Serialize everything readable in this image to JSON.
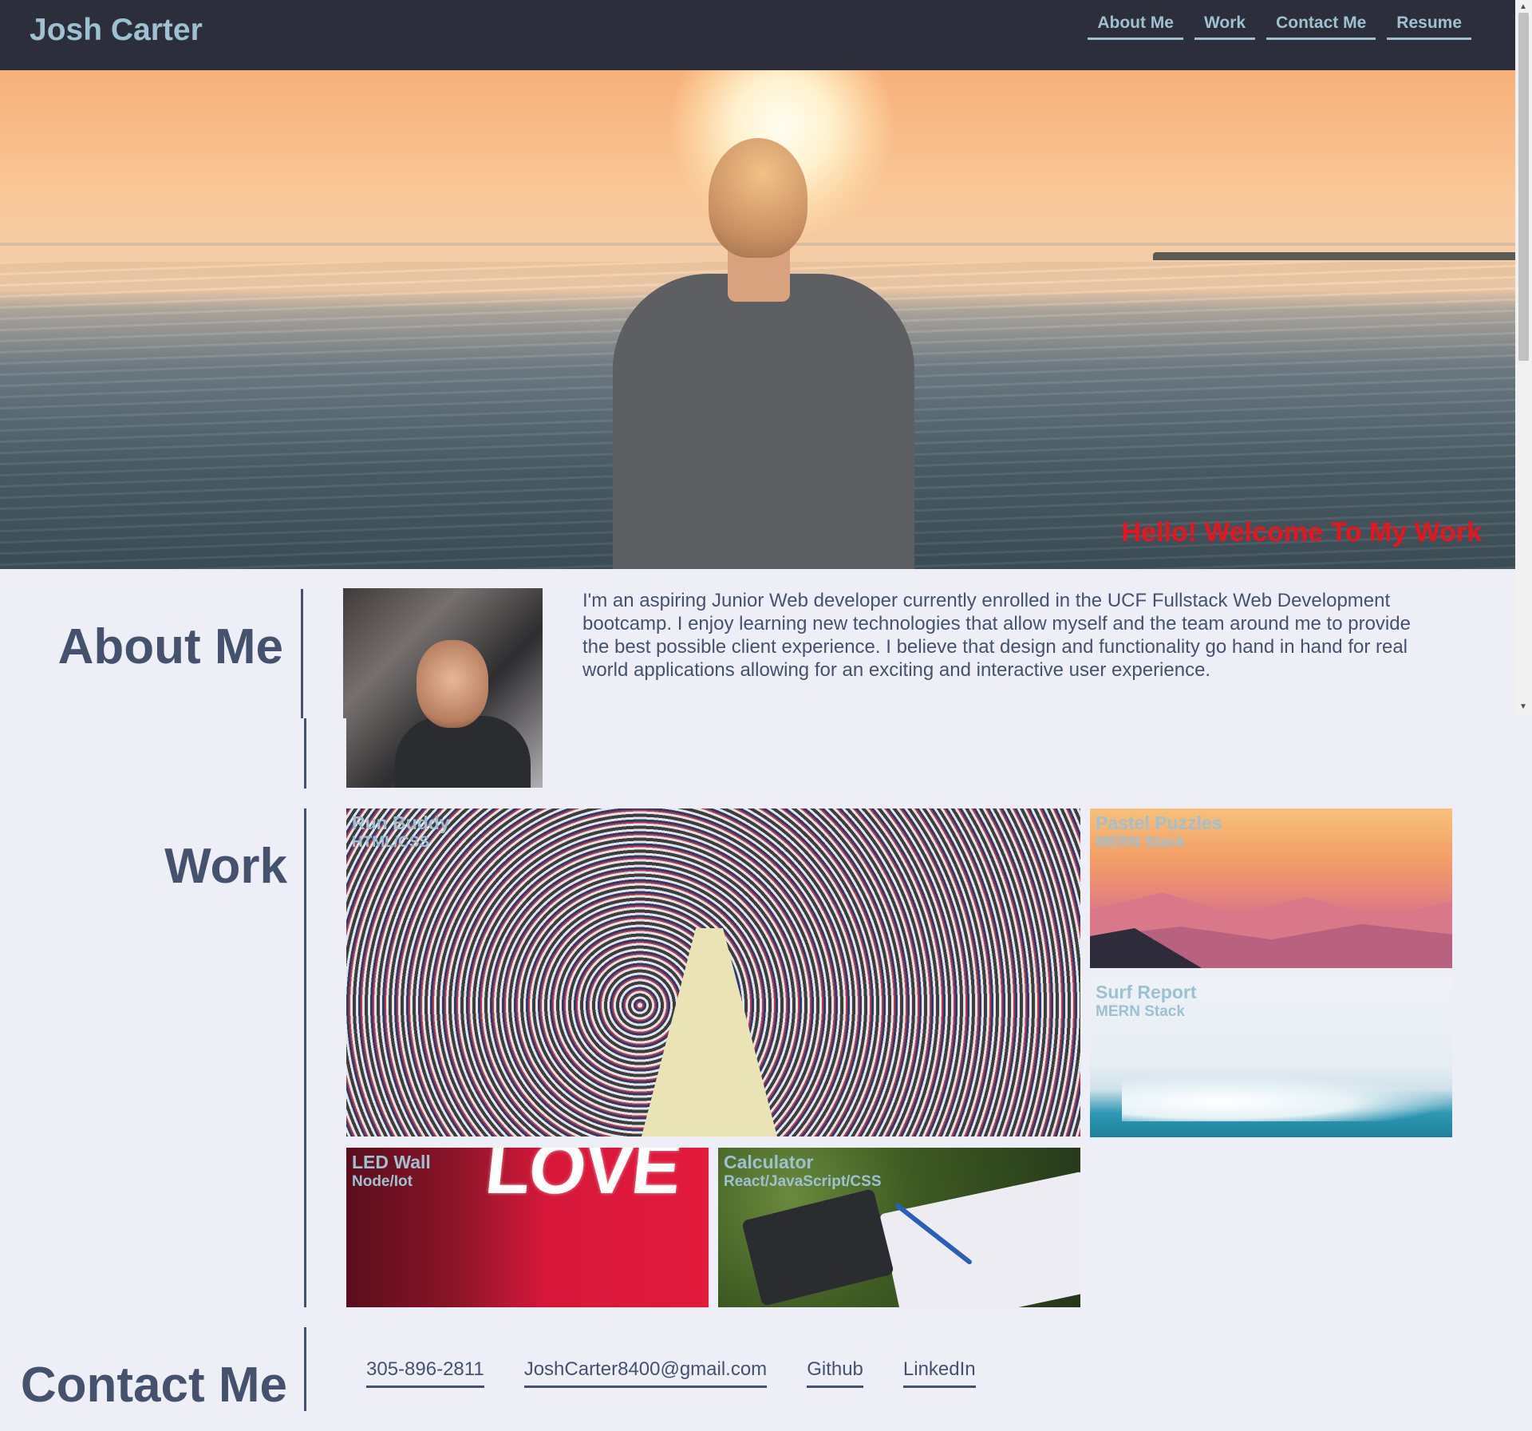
{
  "header": {
    "brand": "Josh Carter",
    "nav": [
      "About Me",
      "Work",
      "Contact Me",
      "Resume"
    ]
  },
  "hero": {
    "welcome": "Hello! Welcome To My Work"
  },
  "about": {
    "title": "About Me",
    "text": "I'm an aspiring Junior Web developer currently enrolled in the UCF Fullstack Web Development bootcamp. I enjoy learning new technologies that allow myself and the team around me to provide the best possible client experience. I believe that design and functionality go hand in hand for real world applications allowing for an exciting and interactive user experience."
  },
  "work": {
    "title": "Work",
    "projects": [
      {
        "name": "Run Buddy",
        "tech": "HTML/CSS"
      },
      {
        "name": "Pastel Puzzles",
        "tech": "MERN Stack"
      },
      {
        "name": "Surf Report",
        "tech": "MERN Stack"
      },
      {
        "name": "LED Wall",
        "tech": "Node/Iot"
      },
      {
        "name": "Calculator",
        "tech": "React/JavaScript/CSS"
      }
    ],
    "led_neon_text": "LOVE"
  },
  "contact": {
    "title": "Contact Me",
    "links": [
      "305-896-2811",
      "JoshCarter8400@gmail.com",
      "Github",
      "LinkedIn"
    ]
  },
  "colors": {
    "header_bg": "#2c2f3b",
    "accent": "#9dc1d0",
    "text": "#44526e",
    "welcome": "#e8141e",
    "page_bg": "#eeeef6"
  }
}
